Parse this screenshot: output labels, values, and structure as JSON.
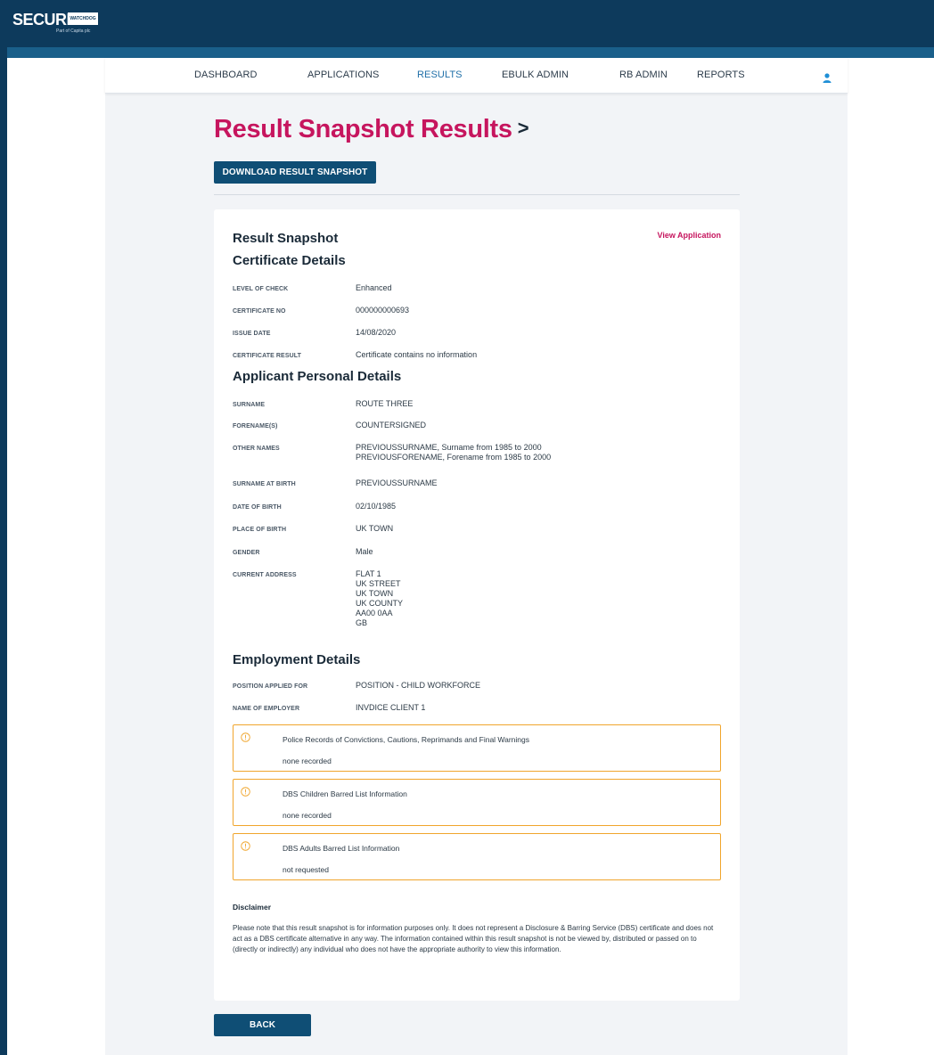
{
  "brand": {
    "logo_text": "SECURITY",
    "logo_badge": "WATCHDOG",
    "logo_sub": "Part of Capita plc"
  },
  "nav": {
    "items": [
      {
        "label": "DASHBOARD"
      },
      {
        "label": "APPLICATIONS"
      },
      {
        "label": "RESULTS"
      },
      {
        "label": "EBULK ADMIN"
      },
      {
        "label": "RB ADMIN"
      },
      {
        "label": "REPORTS"
      }
    ],
    "active": "RESULTS",
    "user_icon": "user-icon"
  },
  "page": {
    "title": "Result Snapshot Results",
    "title_suffix": ">",
    "download_label": "DOWNLOAD RESULT SNAPSHOT",
    "back_label": "BACK"
  },
  "snapshot": {
    "title": "Result Snapshot",
    "view_application": "View Application",
    "certificate": {
      "heading": "Certificate Details",
      "fields": [
        {
          "label": "LEVEL OF CHECK",
          "value": "Enhanced"
        },
        {
          "label": "CERTIFICATE NO",
          "value": "000000000693"
        },
        {
          "label": "ISSUE DATE",
          "value": "14/08/2020"
        },
        {
          "label": "CERTIFICATE RESULT",
          "value": "Certificate contains no information"
        }
      ]
    },
    "applicant": {
      "heading": "Applicant Personal Details",
      "fields": [
        {
          "label": "SURNAME",
          "value": "ROUTE THREE"
        },
        {
          "label": "FORENAME(S)",
          "value": "COUNTERSIGNED"
        },
        {
          "label": "OTHER NAMES",
          "value": "PREVIOUSSURNAME, Surname from 1985 to 2000\nPREVIOUSFORENAME, Forename from 1985 to 2000"
        },
        {
          "label": "SURNAME AT BIRTH",
          "value": "PREVIOUSSURNAME"
        },
        {
          "label": "DATE OF BIRTH",
          "value": "02/10/1985"
        },
        {
          "label": "PLACE OF BIRTH",
          "value": "UK TOWN"
        },
        {
          "label": "GENDER",
          "value": "Male"
        },
        {
          "label": "CURRENT ADDRESS",
          "value": "FLAT 1\nUK STREET\nUK TOWN\nUK COUNTY\nAA00 0AA\nGB"
        }
      ]
    },
    "employment": {
      "heading": "Employment Details",
      "fields": [
        {
          "label": "POSITION APPLIED FOR",
          "value": "POSITION - CHILD WORKFORCE"
        },
        {
          "label": "NAME OF EMPLOYER",
          "value": "INVDICE CLIENT 1"
        }
      ]
    },
    "info_boxes": [
      {
        "title": "Police Records of Convictions, Cautions, Reprimands and Final Warnings",
        "value": "none recorded",
        "icon": "warning-icon"
      },
      {
        "title": "DBS Children Barred List Information",
        "value": "none recorded",
        "icon": "warning-icon"
      },
      {
        "title": "DBS Adults Barred List Information",
        "value": "not requested",
        "icon": "warning-icon"
      }
    ],
    "disclaimer": {
      "title": "Disclaimer",
      "text": "Please note that this result snapshot is for information purposes only. It does not represent a Disclosure & Barring Service (DBS) certificate and does not act as a DBS certificate alternative in any way. The information contained within this result snapshot is not be viewed by, distributed or passed on to (directly or indirectly) any individual who does not have the appropriate authority to view this information."
    }
  },
  "colors": {
    "header_navy": "#0d3a5c",
    "accent_magenta": "#c6155e",
    "button_blue": "#0f4e75",
    "active_nav": "#1f6fa8",
    "warning_border": "#f0a52c"
  }
}
